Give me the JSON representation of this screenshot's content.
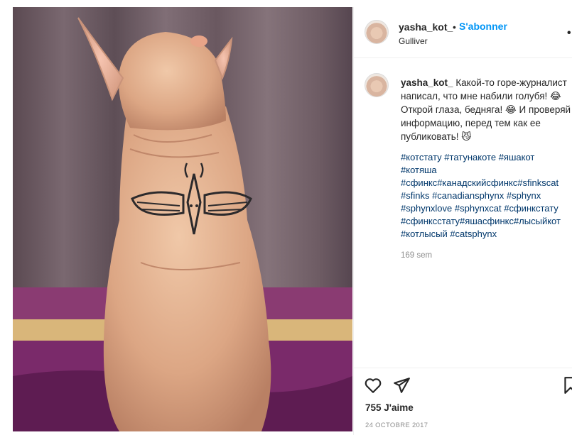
{
  "post": {
    "username": "yasha_kot_",
    "separator": "•",
    "follow_label": "S'abonner",
    "location": "Gulliver",
    "more_label": "•",
    "caption_text": "Какой-то горе-журналист написал, что мне набили голубя! 😂 Открой глаза, бедняга! 😂 И проверяй информацию, перед тем как ее публиковать! 😼",
    "hashtag_lines": [
      "#котстату #татунакоте #яшакот",
      "#котяша",
      "#сфинкс#канадскийсфинкс#sfinkscat",
      "#sfinks #canadiansphynx #sphynx",
      "#sphynxlove #sphynxcat #сфинкстату",
      "#сфинксстату#яшасфинкс#лысыйкот",
      "#котлысый #catsphynx"
    ],
    "time_ago": "169 sem",
    "likes": "755 J'aime",
    "date": "24 OCTOBRE 2017"
  },
  "icons": {
    "like": "heart-icon",
    "share": "send-icon",
    "save": "bookmark-icon",
    "more": "more-options-icon"
  },
  "colors": {
    "follow_accent": "#0095f6",
    "hashtag": "#00376b",
    "muted": "#8e8e8e"
  }
}
